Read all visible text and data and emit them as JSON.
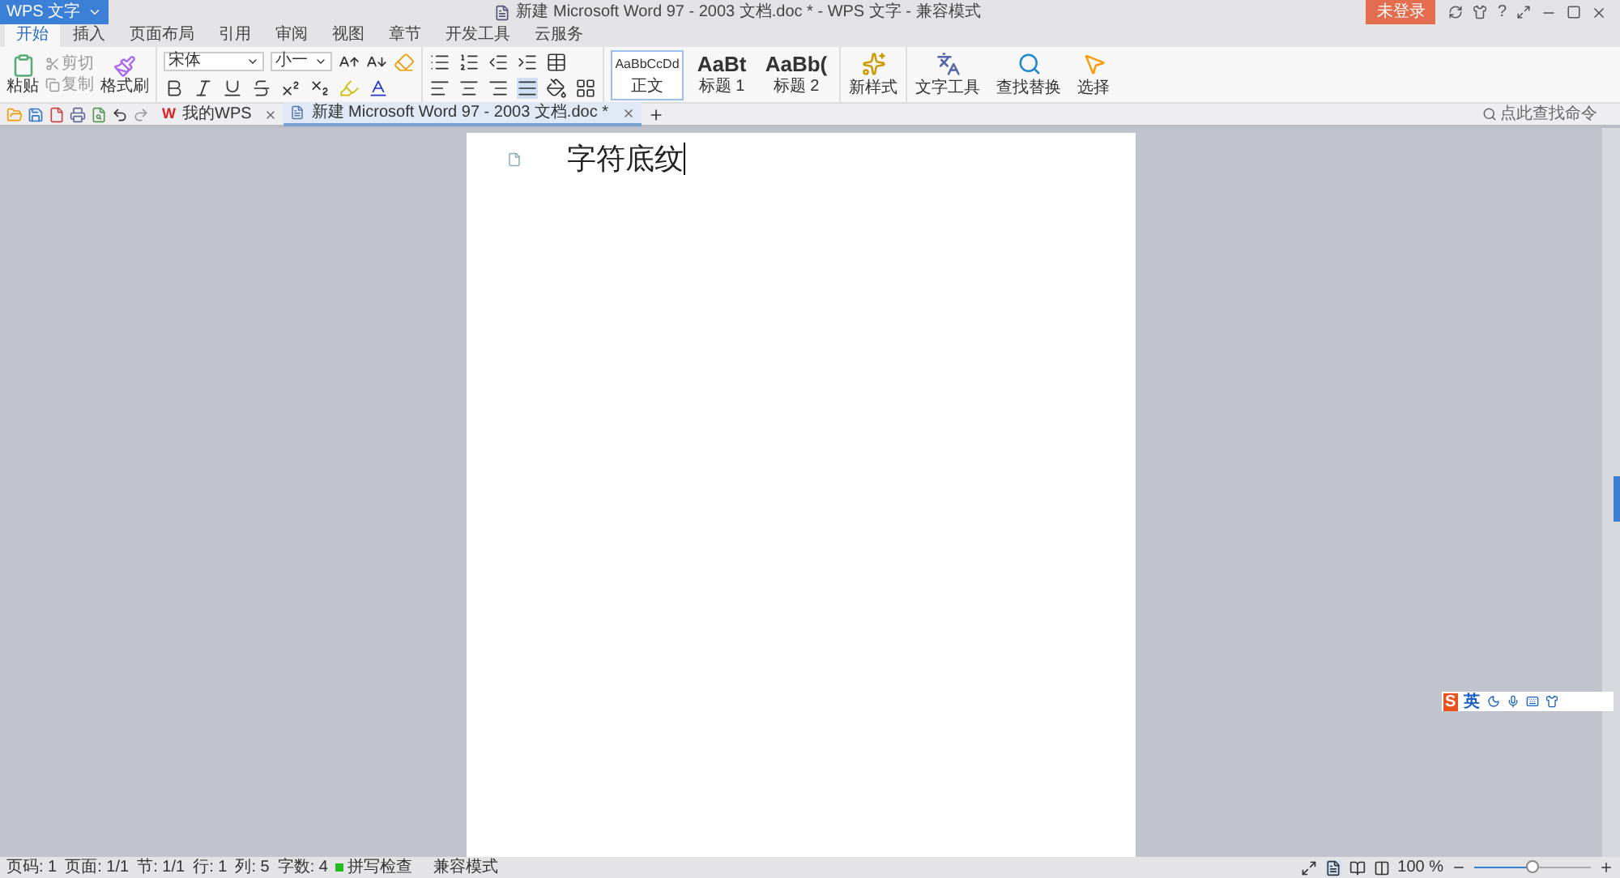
{
  "app_menu": {
    "label": "WPS 文字"
  },
  "window": {
    "title": "新建 Microsoft Word 97 - 2003 文档.doc * - WPS 文字 - 兼容模式",
    "login_button": "未登录",
    "help": "?"
  },
  "ribbon_tabs": [
    {
      "label": "开始",
      "selected": true
    },
    {
      "label": "插入",
      "selected": false
    },
    {
      "label": "页面布局",
      "selected": false
    },
    {
      "label": "引用",
      "selected": false
    },
    {
      "label": "审阅",
      "selected": false
    },
    {
      "label": "视图",
      "selected": false
    },
    {
      "label": "章节",
      "selected": false
    },
    {
      "label": "开发工具",
      "selected": false
    },
    {
      "label": "云服务",
      "selected": false
    }
  ],
  "ribbon": {
    "paste": "粘贴",
    "cut": "剪切",
    "copy": "复制",
    "format_painter": "格式刷",
    "font_name": "宋体",
    "font_size": "小一",
    "styles": [
      {
        "preview": "AaBbCcDd",
        "label": "正文",
        "selected": true
      },
      {
        "preview": "AaBt",
        "label": "标题 1",
        "selected": false
      },
      {
        "preview": "AaBb(",
        "label": "标题 2",
        "selected": false
      }
    ],
    "new_style": "新样式",
    "text_tools": "文字工具",
    "find_replace": "查找替换",
    "select": "选择"
  },
  "doc_tabs": [
    {
      "logo": "W",
      "label": "我的WPS",
      "selected": false
    },
    {
      "label": "新建 Microsoft Word 97 - 2003 文档.doc *",
      "selected": true
    }
  ],
  "command_search": {
    "placeholder": "点此查找命令"
  },
  "document": {
    "text": "字符底纹"
  },
  "ime_toolbar": {
    "logo": "S",
    "mode": "英"
  },
  "status_bar": {
    "items": [
      "页码: 1",
      "页面: 1/1",
      "节: 1/1",
      "行: 1",
      "列: 5",
      "字数: 4"
    ],
    "spell_check": {
      "label": "拼写检查",
      "on": true
    },
    "mode": "兼容模式",
    "zoom": "100 %",
    "zoom_slider": {
      "level": 0.5
    }
  }
}
